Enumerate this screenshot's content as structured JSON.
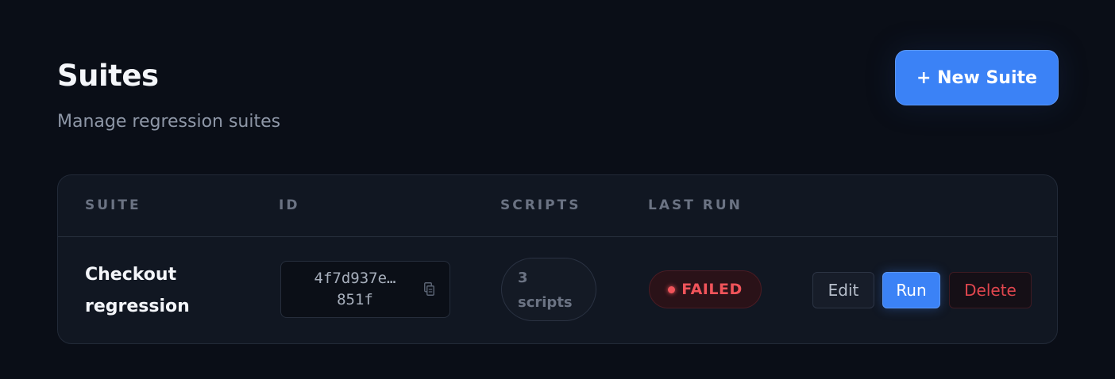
{
  "header": {
    "title": "Suites",
    "subtitle": "Manage regression suites",
    "new_button_label": "+ New Suite"
  },
  "table": {
    "columns": [
      "SUITE",
      "ID",
      "SCRIPTS",
      "LAST RUN"
    ],
    "rows": [
      {
        "suite_name": "Checkout regression",
        "id_line1": "4f7d937e…",
        "id_line2": "851f",
        "scripts_line1": "3",
        "scripts_line2": "scripts",
        "last_run": "FAILED",
        "actions": {
          "edit": "Edit",
          "run": "Run",
          "delete": "Delete"
        }
      }
    ]
  },
  "colors": {
    "background": "#0a0e17",
    "card": "#111722",
    "accent": "#3b82f6",
    "failed": "#f0545a"
  },
  "icons": {
    "copy": "copy-icon",
    "status": "status-dot"
  }
}
